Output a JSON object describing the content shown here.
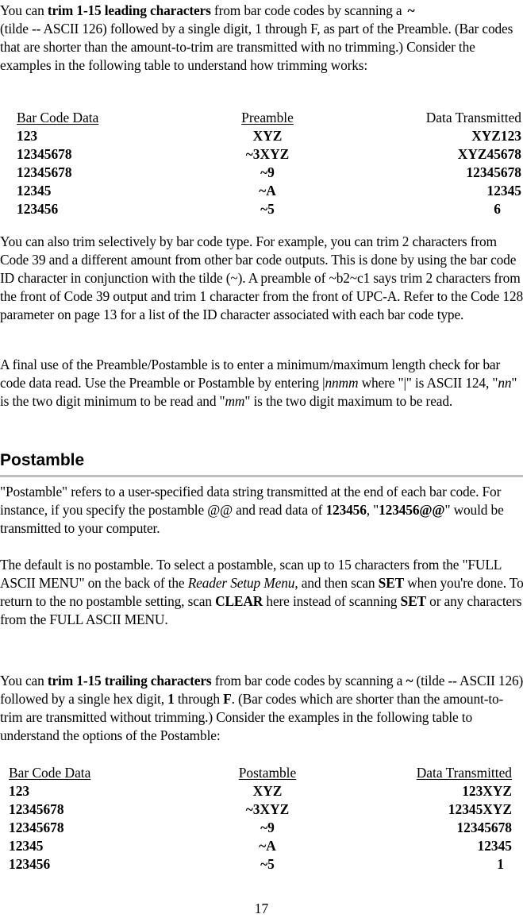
{
  "intro_paragraph": {
    "t1": "You can ",
    "b1": "trim 1-15 leading characters",
    "t2": " from bar code codes by scanning a ",
    "b2": "~",
    "t3": "(tilde -- ASCII 126) followed by a single digit, 1 through F, as part of the Preamble. (Bar codes that are shorter than the amount-to-trim are transmitted with no trimming.)  Consider the examples in the following table to understand how trimming works:"
  },
  "preamble_table": {
    "headers": [
      "Bar Code Data",
      "Preamble",
      "Data Transmitted"
    ],
    "rows": [
      [
        "123",
        "XYZ",
        "XYZ123"
      ],
      [
        "12345678",
        "~3XYZ",
        "XYZ45678"
      ],
      [
        "12345678",
        "~9",
        "12345678"
      ],
      [
        "12345",
        "~A",
        "12345"
      ],
      [
        "123456",
        "~5",
        "6"
      ]
    ]
  },
  "selective_trim_paragraph": "You can also trim selectively by bar code type. For example, you can trim 2 characters from Code 39 and a different amount from other bar code outputs. This is done by using the bar code ID character in conjunction with the tilde (~).  A preamble of ~b2~c1 says trim 2 characters from the front of Code 39 output and trim 1 character from the front of UPC-A. Refer to the Code 128 parameter on page 13 for a list of the ID character associated with each bar code type.",
  "length_check_paragraph": {
    "t1": "A final use of the Preamble/Postamble is to enter a minimum/maximum length check for bar code data read.  Use the Preamble or Postamble by entering |",
    "i1": "nnmm",
    "t2": " where \"|\" is ASCII 124,  \"",
    "i2": "nn",
    "t3": "\" is the two digit minimum to be read and \"",
    "i3": "mm",
    "t4": "\" is the two digit maximum to be read."
  },
  "postamble_heading": "Postamble",
  "postamble_intro": {
    "t1": "\"Postamble\" refers to a user-specified data string transmitted at the end of each bar code.  For instance, if you specify the postamble @@ and read data of ",
    "b1": "123456",
    "t2": ", \"",
    "b2": "123456@@",
    "t3": "\" would be transmitted to your computer."
  },
  "default_paragraph": {
    "t1": "The default is no postamble.  To select a postamble, scan up to 15 characters from the \"FULL ASCII MENU\" on the back of the ",
    "i1": "Reader Setup Menu",
    "t2": ", and then scan ",
    "b1": "SET",
    "t3": " when you're done.  To return to the no postamble setting, scan ",
    "b2": "CLEAR",
    "t4": " here instead of scanning ",
    "b3": "SET",
    "t5": " or any characters from the FULL ASCII MENU."
  },
  "trailing_paragraph": {
    "t1": "You can ",
    "b1": "trim 1-15 trailing characters",
    "t2": " from bar code codes by scanning a ",
    "b2": "~",
    "t3": " (tilde -- ASCII 126) followed by a single hex digit, ",
    "b3": "1",
    "t4": " through ",
    "b4": "F",
    "t5": ". (Bar codes which are shorter than the amount-to-trim are transmitted without trimming.)  Consider the examples in the following table to understand the options of the Postamble:"
  },
  "postamble_table": {
    "headers": [
      "Bar Code Data",
      "Postamble",
      "Data Transmitted"
    ],
    "rows": [
      [
        "123",
        "XYZ",
        "123XYZ"
      ],
      [
        "12345678",
        "~3XYZ",
        "12345XYZ"
      ],
      [
        "12345678",
        "~9",
        "12345678"
      ],
      [
        "12345",
        "~A",
        "12345"
      ],
      [
        "123456",
        "~5",
        "1"
      ]
    ]
  },
  "page_number": "17"
}
